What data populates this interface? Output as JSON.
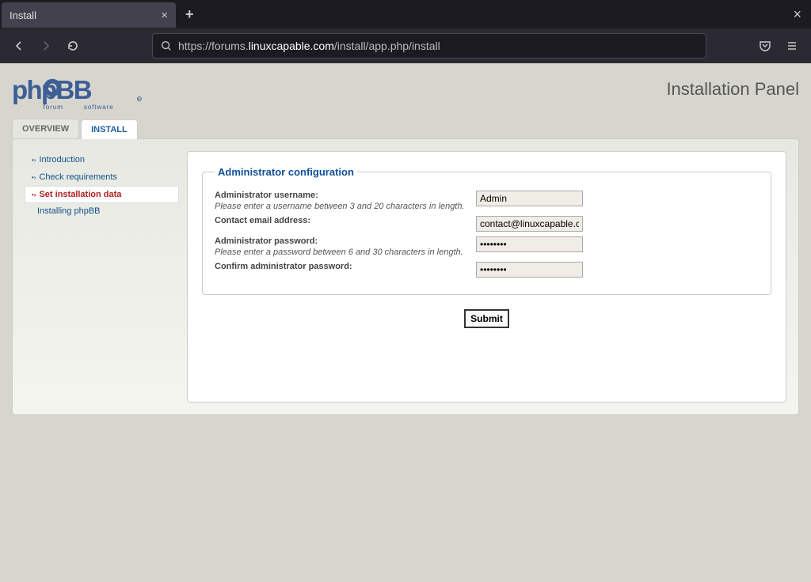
{
  "browser": {
    "tab_title": "Install",
    "url_pre": "https://forums.",
    "url_host": "linuxcapable.com",
    "url_path": "/install/app.php/install"
  },
  "header": {
    "panel_title": "Installation Panel"
  },
  "tabs": {
    "overview": "OVERVIEW",
    "install": "INSTALL"
  },
  "sidebar": {
    "intro": "Introduction",
    "check": "Check requirements",
    "set": "Set installation data",
    "installing": "Installing phpBB"
  },
  "form": {
    "legend": "Administrator configuration",
    "username_label": "Administrator username:",
    "username_explain": "Please enter a username between 3 and 20 characters in length.",
    "username_value": "Admin",
    "email_label": "Contact email address:",
    "email_value": "contact@linuxcapable.com",
    "password_label": "Administrator password:",
    "password_explain": "Please enter a password between 6 and 30 characters in length.",
    "password_value": "••••••••",
    "confirm_label": "Confirm administrator password:",
    "confirm_value": "••••••••",
    "submit": "Submit"
  }
}
